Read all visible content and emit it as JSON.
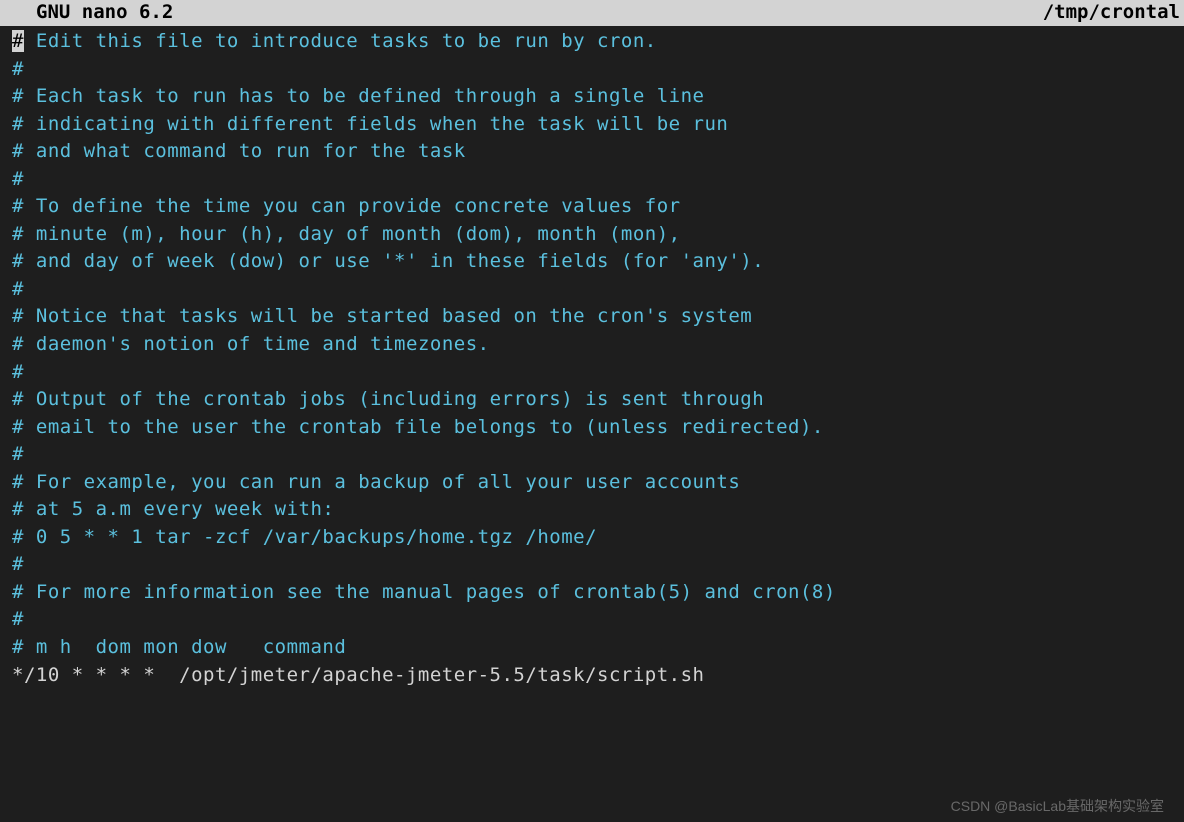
{
  "header": {
    "left": "GNU nano 6.2",
    "right": "/tmp/crontal"
  },
  "lines": [
    {
      "prefix_highlight": "#",
      "text": " Edit this file to introduce tasks to be run by cron.",
      "is_comment": true
    },
    {
      "prefix": "#",
      "text": "",
      "is_comment": true
    },
    {
      "prefix": "#",
      "text": " Each task to run has to be defined through a single line",
      "is_comment": true
    },
    {
      "prefix": "#",
      "text": " indicating with different fields when the task will be run",
      "is_comment": true
    },
    {
      "prefix": "#",
      "text": " and what command to run for the task",
      "is_comment": true
    },
    {
      "prefix": "#",
      "text": "",
      "is_comment": true
    },
    {
      "prefix": "#",
      "text": " To define the time you can provide concrete values for",
      "is_comment": true
    },
    {
      "prefix": "#",
      "text": " minute (m), hour (h), day of month (dom), month (mon),",
      "is_comment": true
    },
    {
      "prefix": "#",
      "text": " and day of week (dow) or use '*' in these fields (for 'any').",
      "is_comment": true
    },
    {
      "prefix": "#",
      "text": "",
      "is_comment": true
    },
    {
      "prefix": "#",
      "text": " Notice that tasks will be started based on the cron's system",
      "is_comment": true
    },
    {
      "prefix": "#",
      "text": " daemon's notion of time and timezones.",
      "is_comment": true
    },
    {
      "prefix": "#",
      "text": "",
      "is_comment": true
    },
    {
      "prefix": "#",
      "text": " Output of the crontab jobs (including errors) is sent through",
      "is_comment": true
    },
    {
      "prefix": "#",
      "text": " email to the user the crontab file belongs to (unless redirected).",
      "is_comment": true
    },
    {
      "prefix": "#",
      "text": "",
      "is_comment": true
    },
    {
      "prefix": "#",
      "text": " For example, you can run a backup of all your user accounts",
      "is_comment": true
    },
    {
      "prefix": "#",
      "text": " at 5 a.m every week with:",
      "is_comment": true
    },
    {
      "prefix": "#",
      "text": " 0 5 * * 1 tar -zcf /var/backups/home.tgz /home/",
      "is_comment": true
    },
    {
      "prefix": "#",
      "text": "",
      "is_comment": true
    },
    {
      "prefix": "#",
      "text": " For more information see the manual pages of crontab(5) and cron(8)",
      "is_comment": true
    },
    {
      "prefix": "#",
      "text": "",
      "is_comment": true
    },
    {
      "prefix": "#",
      "text": " m h  dom mon dow   command",
      "is_comment": true
    },
    {
      "prefix": "",
      "text": "*/10 * * * *  /opt/jmeter/apache-jmeter-5.5/task/script.sh",
      "is_comment": false
    }
  ],
  "watermark": "CSDN @BasicLab基础架构实验室"
}
